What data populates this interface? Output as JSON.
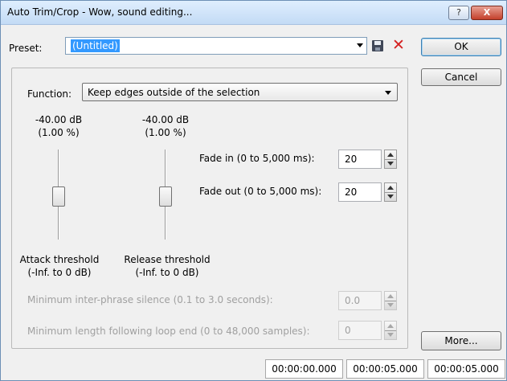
{
  "window": {
    "title": "Auto Trim/Crop - Wow, sound editing..."
  },
  "titlebar": {
    "help_label": "?",
    "close_label": "X"
  },
  "preset": {
    "label": "Preset:",
    "value": "(Untitled)"
  },
  "buttons": {
    "ok": "OK",
    "cancel": "Cancel",
    "more": "More..."
  },
  "function": {
    "label": "Function:",
    "selected": "Keep edges outside of the selection"
  },
  "attack": {
    "db": "-40.00 dB",
    "percent": "(1.00 %)",
    "caption": "Attack threshold",
    "range": "(-Inf. to 0 dB)"
  },
  "release": {
    "db": "-40.00 dB",
    "percent": "(1.00 %)",
    "caption": "Release threshold",
    "range": "(-Inf. to 0 dB)"
  },
  "fade_in": {
    "label": "Fade in (0 to 5,000 ms):",
    "value": "20"
  },
  "fade_out": {
    "label": "Fade out (0 to 5,000 ms):",
    "value": "20"
  },
  "min_silence": {
    "label": "Minimum inter-phrase silence (0.1 to 3.0 seconds):",
    "value": "0.0"
  },
  "min_loop": {
    "label": "Minimum length following loop end (0 to 48,000 samples):",
    "value": "0"
  },
  "status": {
    "start": "00:00:00.000",
    "end": "00:00:05.000",
    "length": "00:00:05.000"
  }
}
